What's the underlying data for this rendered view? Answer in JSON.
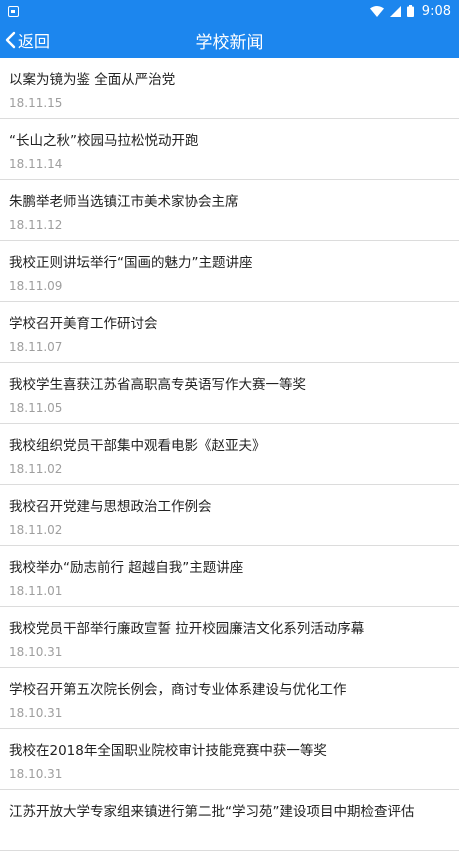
{
  "status_bar": {
    "time": "9:08",
    "icons": [
      "notification-icon",
      "wifi-icon",
      "signal-icon",
      "battery-icon"
    ]
  },
  "header": {
    "back_label": "返回",
    "title": "学校新闻",
    "color": "#1c86ee"
  },
  "news": [
    {
      "title": "以案为镜为鉴 全面从严治党",
      "date": "18.11.15"
    },
    {
      "title": "“长山之秋”校园马拉松悦动开跑",
      "date": "18.11.14"
    },
    {
      "title": "朱鹏举老师当选镇江市美术家协会主席",
      "date": "18.11.12"
    },
    {
      "title": "我校正则讲坛举行“国画的魅力”主题讲座",
      "date": "18.11.09"
    },
    {
      "title": "学校召开美育工作研讨会",
      "date": "18.11.07"
    },
    {
      "title": "我校学生喜获江苏省高职高专英语写作大赛一等奖",
      "date": "18.11.05"
    },
    {
      "title": "我校组织党员干部集中观看电影《赵亚夫》",
      "date": "18.11.02"
    },
    {
      "title": "我校召开党建与思想政治工作例会",
      "date": "18.11.02"
    },
    {
      "title": "我校举办“励志前行 超越自我”主题讲座",
      "date": "18.11.01"
    },
    {
      "title": "我校党员干部举行廉政宣誓 拉开校园廉洁文化系列活动序幕",
      "date": "18.10.31"
    },
    {
      "title": "学校召开第五次院长例会，商讨专业体系建设与优化工作",
      "date": "18.10.31"
    },
    {
      "title": "我校在2018年全国职业院校审计技能竞赛中获一等奖",
      "date": "18.10.31"
    },
    {
      "title": "江苏开放大学专家组来镇进行第二批“学习苑”建设项目中期检查评估",
      "date": ""
    }
  ]
}
